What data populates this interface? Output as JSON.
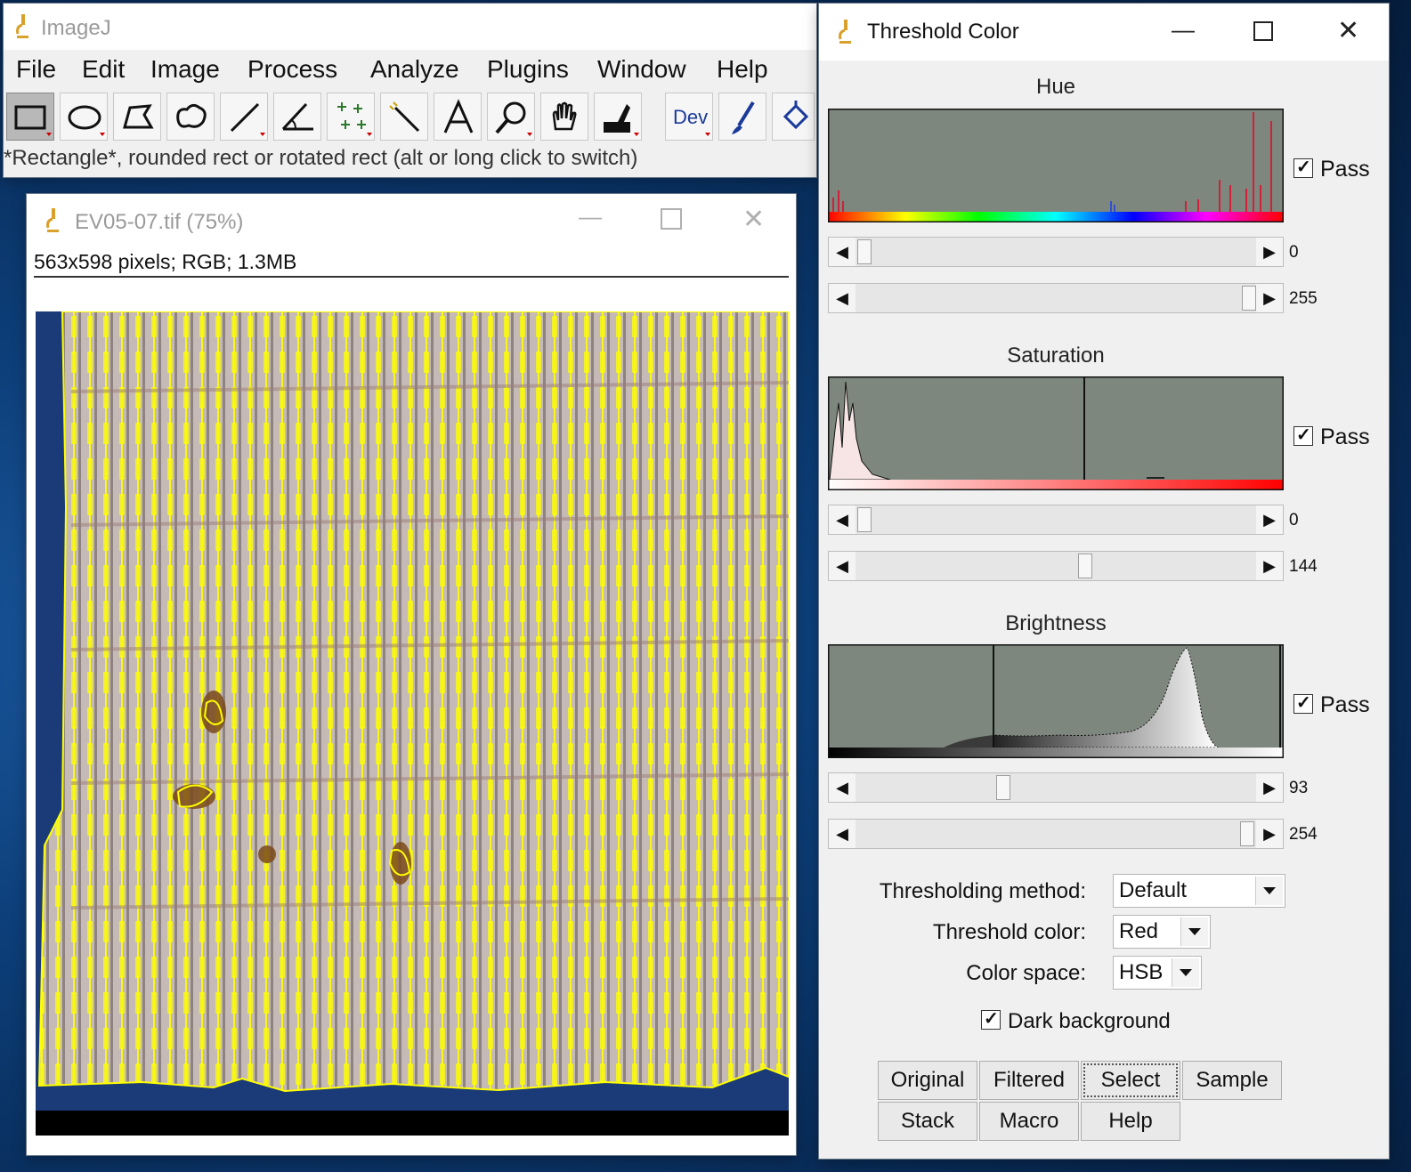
{
  "imagej": {
    "title": "ImageJ",
    "menus": [
      "File",
      "Edit",
      "Image",
      "Process",
      "Analyze",
      "Plugins",
      "Window",
      "Help"
    ],
    "tools": [
      "rectangle-tool",
      "oval-tool",
      "polygon-tool",
      "freehand-tool",
      "line-tool",
      "angle-tool",
      "multipoint-tool",
      "wand-tool",
      "text-tool",
      "magnifier-tool",
      "hand-tool",
      "color-picker-tool",
      "dev-menu-tool",
      "brush-tool",
      "flood-fill-tool"
    ],
    "dev_label": "Dev",
    "status": "*Rectangle*, rounded rect or rotated rect (alt or long click to switch)"
  },
  "image_window": {
    "title": "EV05-07.tif (75%)",
    "info": "563x598 pixels; RGB; 1.3MB"
  },
  "threshold": {
    "title": "Threshold Color",
    "hue": {
      "label": "Hue",
      "pass_label": "Pass",
      "pass": true,
      "min": "0",
      "max": "255"
    },
    "saturation": {
      "label": "Saturation",
      "pass_label": "Pass",
      "pass": true,
      "min": "0",
      "max": "144"
    },
    "brightness": {
      "label": "Brightness",
      "pass_label": "Pass",
      "pass": true,
      "min": "93",
      "max": "254"
    },
    "method_label": "Thresholding method:",
    "method_value": "Default",
    "color_label": "Threshold color:",
    "color_value": "Red",
    "space_label": "Color space:",
    "space_value": "HSB",
    "dark_bg_label": "Dark background",
    "dark_bg": true,
    "buttons": [
      "Original",
      "Filtered",
      "Select",
      "Sample",
      "Stack",
      "Macro",
      "Help"
    ]
  },
  "colors": {
    "selection": "#ffff00",
    "hist_bg": "#7d877e",
    "background_blue": "#0d3f7a"
  }
}
